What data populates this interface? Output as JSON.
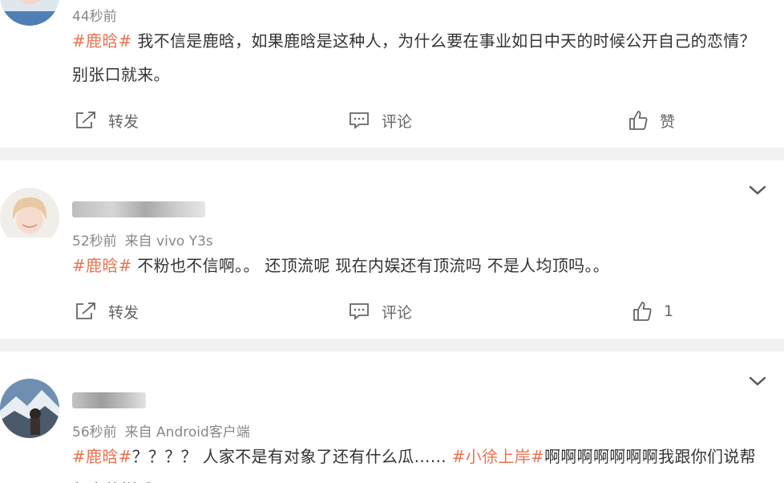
{
  "posts": [
    {
      "time": "44秒前",
      "source": "",
      "tag": "#鹿晗#",
      "text": " 我不信是鹿晗，如果鹿晗是这种人，为什么要在事业如日中天的时候公开自己的恋情？别张口就来。",
      "repost_label": "转发",
      "comment_label": "评论",
      "like_label": "赞"
    },
    {
      "time": "52秒前",
      "source": "来自 vivo Y3s",
      "tag": "#鹿晗#",
      "text": " 不粉也不信啊。。 还顶流呢 现在内娱还有顶流吗 不是人均顶吗。。",
      "repost_label": "转发",
      "comment_label": "评论",
      "like_label": "1"
    },
    {
      "time": "56秒前",
      "source": "来自 Android客户端",
      "tag": "#鹿晗#",
      "text_mid": "？？？？ 人家不是有对象了还有什么瓜…… ",
      "tag2": "#小徐上岸#",
      "text_end": "啊啊啊啊啊啊啊我跟你们说帮帮大的样哦lol"
    }
  ],
  "colors": {
    "accent": "#eb7350",
    "separator": "#f2f2f2",
    "meta": "#888888"
  },
  "icons": [
    "repost-icon",
    "comment-icon",
    "like-icon",
    "chevron-down-icon"
  ]
}
